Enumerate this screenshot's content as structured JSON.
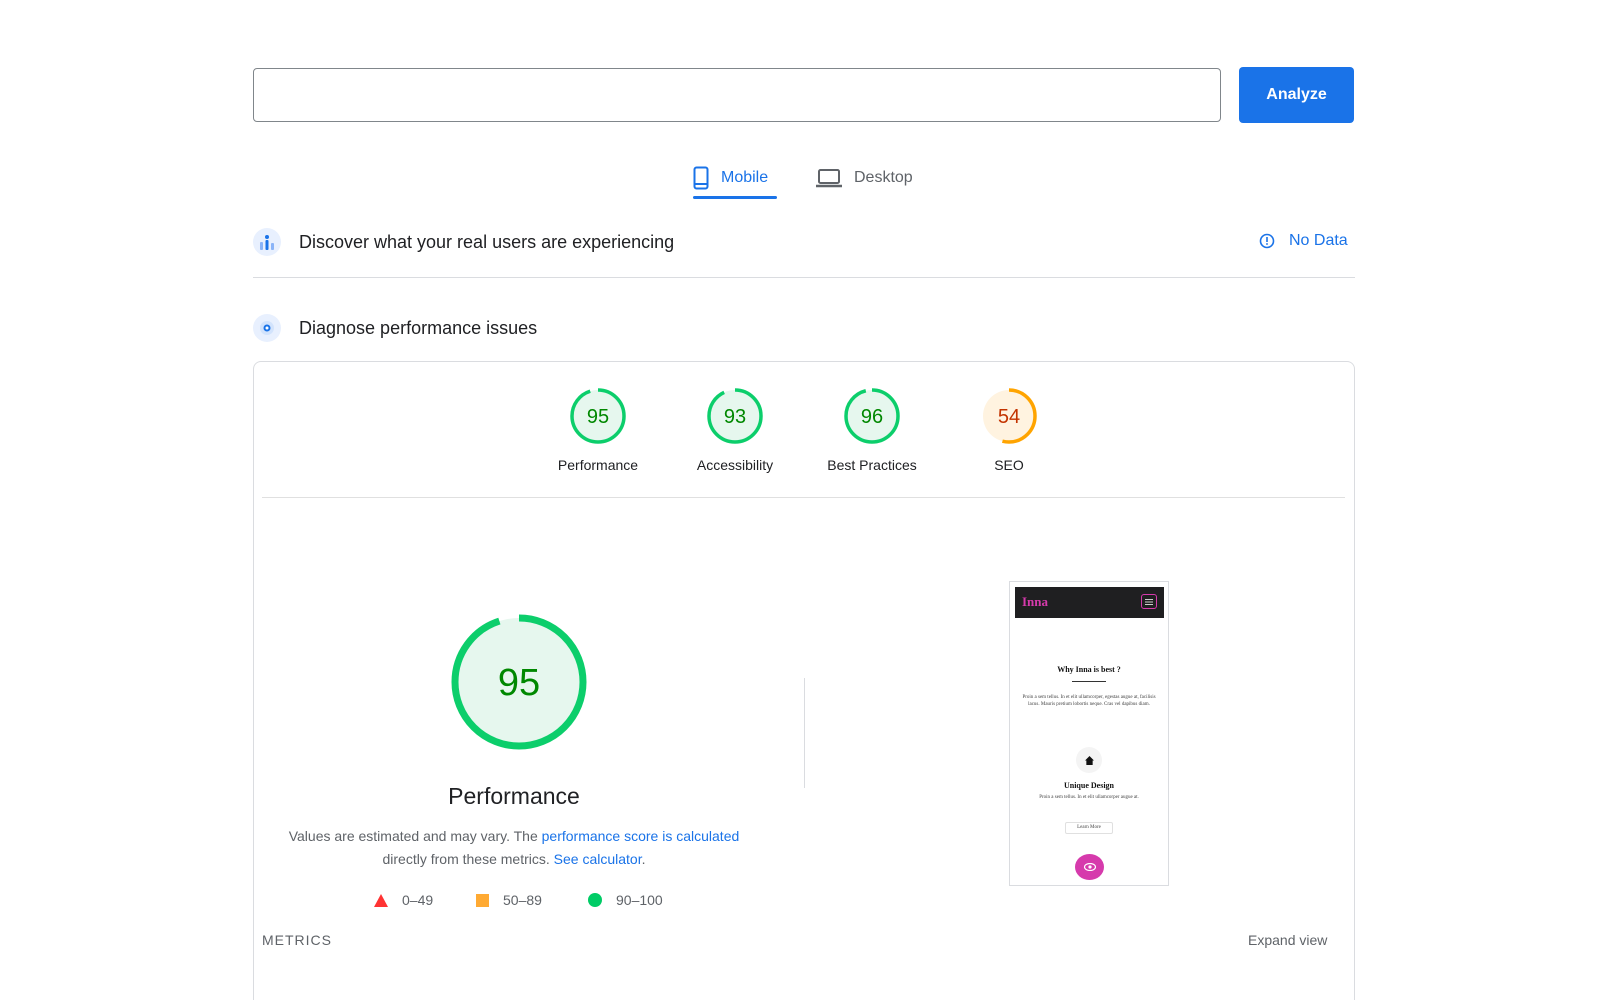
{
  "search": {
    "value": "",
    "placeholder": ""
  },
  "analyze_label": "Analyze",
  "tabs": [
    {
      "label": "Mobile",
      "icon": "smartphone-icon",
      "active": true
    },
    {
      "label": "Desktop",
      "icon": "laptop-icon",
      "active": false
    }
  ],
  "field_data": {
    "title": "Discover what your real users are experiencing",
    "icon": "users-chart-icon",
    "status": "No Data",
    "status_icon": "info-icon"
  },
  "lab_data": {
    "title": "Diagnose performance issues",
    "icon": "lighthouse-icon"
  },
  "categories": [
    {
      "label": "Performance",
      "score": 95
    },
    {
      "label": "Accessibility",
      "score": 93
    },
    {
      "label": "Best Practices",
      "score": 96
    },
    {
      "label": "SEO",
      "score": 54
    }
  ],
  "performance": {
    "title": "Performance",
    "score": 95,
    "desc_prefix": "Values are estimated and may vary. The ",
    "desc_link": "performance score is calculated",
    "desc_middle": " directly from these metrics. ",
    "desc_link2": "See calculator",
    "desc_suffix": "."
  },
  "legend": [
    {
      "range": "0–49",
      "shape": "triangle",
      "color": "#f33"
    },
    {
      "range": "50–89",
      "shape": "square",
      "color": "#fa3"
    },
    {
      "range": "90–100",
      "shape": "circle",
      "color": "#0c6"
    }
  ],
  "screenshot": {
    "logo": "Inna",
    "heading": "Why Inna is best ?",
    "paragraph": "Proin a sem tellus. In et elit ullamcorper, egestas augue at, facilisis lacus. Mauris pretium lobortis neque. Cras vel dapibus diam.",
    "feature_title": "Unique Design",
    "feature_text": "Proin a sem tellus. In et elit ullamcorper augue at.",
    "button": "Learn More"
  },
  "metrics_label": "METRICS",
  "expand_label": "Expand view",
  "colors": {
    "accent": "#1a73e8",
    "pass": "#0cce6b",
    "pass_bg": "#e6f7ee",
    "average": "#ffa400",
    "average_text": "#c33300",
    "average_bg": "#fff3e0"
  }
}
